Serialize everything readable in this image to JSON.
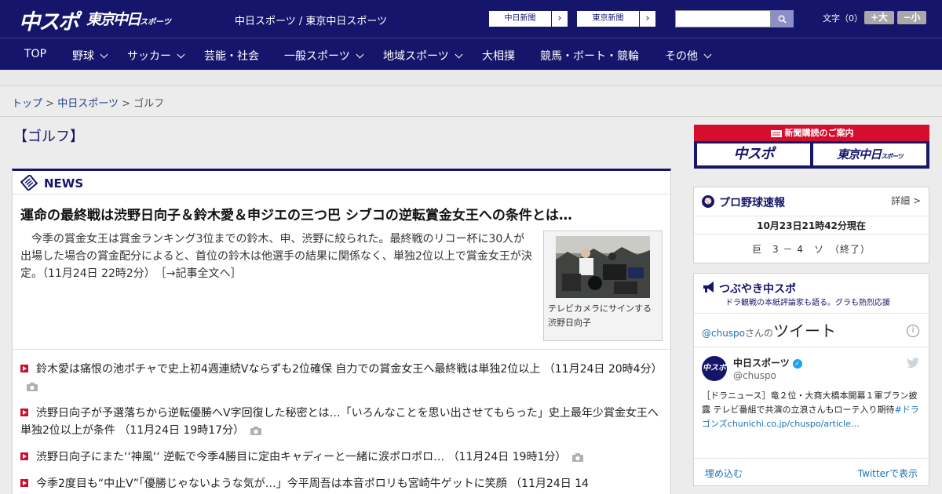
{
  "header": {
    "logo_chuspo": "中スポ",
    "logo_tokyo": "東京中日",
    "logo_tokyo_small": "スポーツ",
    "site_name": "中日スポーツ / 東京中日スポーツ",
    "btn_chunichi": "中日新聞",
    "btn_tokyo": "東京新聞",
    "search_placeholder": "",
    "font_size_label": "文字（0）",
    "font_larger": "+大",
    "font_smaller": "−小"
  },
  "nav": {
    "items": [
      {
        "label": "TOP"
      },
      {
        "label": "野球"
      },
      {
        "label": "サッカー"
      },
      {
        "label": "芸能・社会"
      },
      {
        "label": "一般スポーツ"
      },
      {
        "label": "地域スポーツ"
      },
      {
        "label": "大相撲"
      },
      {
        "label": "競馬・ボート・競輪"
      },
      {
        "label": "その他"
      }
    ]
  },
  "breadcrumb": {
    "home": "トップ",
    "section": "中日スポーツ",
    "current": "ゴルフ",
    "sep": ">"
  },
  "main": {
    "page_title": "【ゴルフ】",
    "news_label": "NEWS",
    "lead": {
      "title": "運命の最終戦は渋野日向子＆鈴木愛＆申ジエの三つ巴 シブコの逆転賞金女王への条件とは…",
      "body": "今季の賞金女王は賞金ランキング3位までの鈴木、申、渋野に絞られた。最終戦のリコー杯に30人が出場した場合の賞金配分によると、首位の鈴木は他選手の結果に関係なく、単独2位以上で賞金女王が決定。（11月24日 22時2分）　［→記事全文へ］",
      "photo_caption": "テレビカメラにサインする渋野日向子"
    },
    "news": [
      {
        "text": "鈴木愛は痛恨の池ポチャで史上初4週連続Vならずも2位確保 自力での賞金女王へ最終戦は単独2位以上 （11月24日 20時4分）"
      },
      {
        "text": "渋野日向子が予選落ちから逆転優勝へV字回復した秘密とは…「いろんなことを思い出させてもらった」史上最年少賞金女王へ単独2位以上が条件 （11月24日 19時17分）"
      },
      {
        "text": "渋野日向子にまた‘‘神風‘‘ 逆転で今季4勝目に定由キャディーと一緒に涙ポロポロ… （11月24日 19時1分）"
      },
      {
        "text": "今季2度目も“中止V”「優勝じゃないような気が…」今平周吾は本音ポロリも宮崎牛ゲットに笑顔 （11月24日 14"
      }
    ]
  },
  "sidebar": {
    "subscription_header": "新聞購読のご案内",
    "sub_logo_chuspo": "中スポ",
    "sub_logo_tokyo": "東京中日",
    "sub_logo_tokyo_small": "スポーツ",
    "baseball": {
      "title": "プロ野球速報",
      "detail": "詳細 >",
      "time": "10月23日21時42分現在",
      "score": "巨　3 － 4　ソ　（終了）"
    },
    "twitter": {
      "title": "つぶやき中スポ",
      "subtitle": "ドラ観戦の本紙評論家も語る。グラも熱烈応援",
      "handle": "@chuspo",
      "handle_suffix": "さんの",
      "heading": "ツイート",
      "name": "中日スポーツ",
      "user": "@chuspo",
      "avatar_text": "中スポ",
      "tweet_text": "［ドラニュース］竜２位・大商大橋本開幕１軍プラン披露 テレビ番組で共演の立浪さんもローテ入り期待",
      "tweet_tag": "#ドラゴンズ",
      "tweet_link": "chunichi.co.jp/chuspo/article…",
      "embed": "埋め込む",
      "view": "Twitterで表示"
    }
  }
}
